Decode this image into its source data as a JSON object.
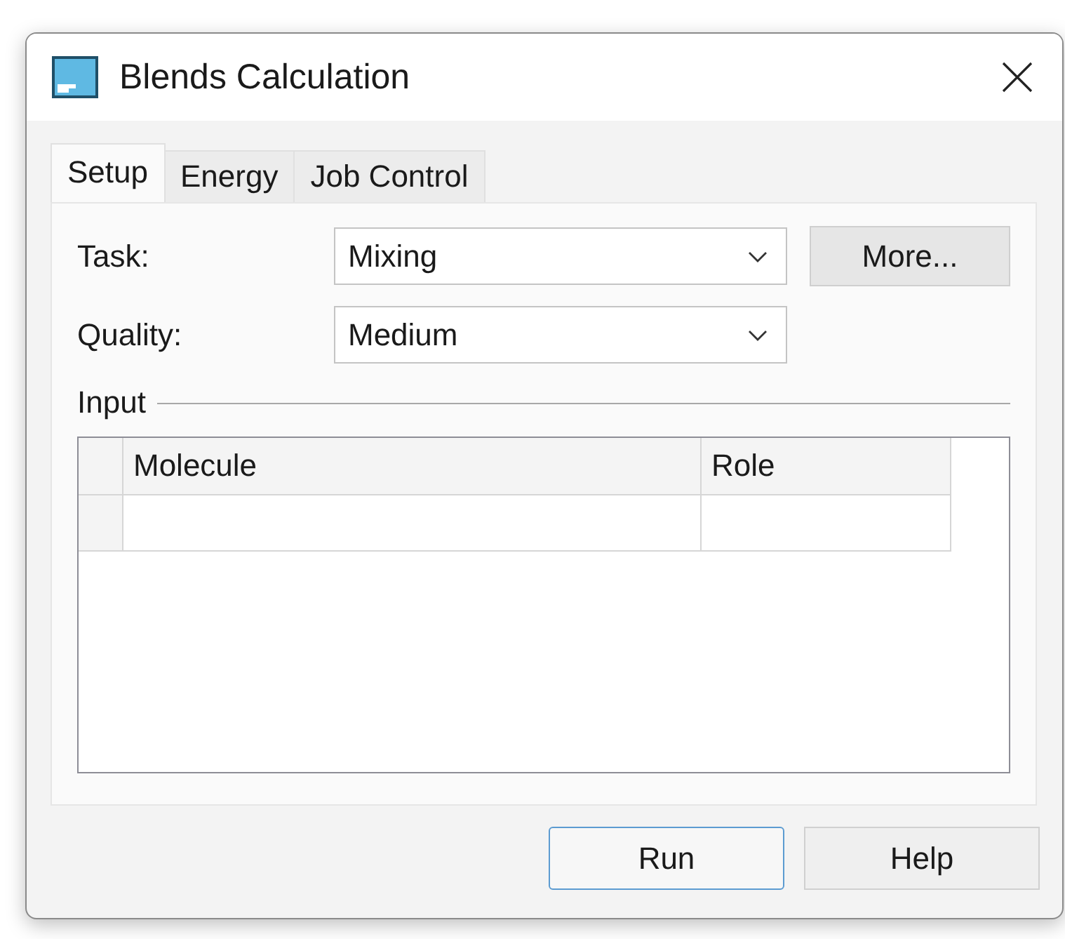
{
  "window": {
    "title": "Blends Calculation"
  },
  "tabs": [
    {
      "label": "Setup",
      "selected": true
    },
    {
      "label": "Energy",
      "selected": false
    },
    {
      "label": "Job Control",
      "selected": false
    }
  ],
  "fields": [
    {
      "label": "Task:",
      "value": "Mixing"
    },
    {
      "label": "Quality:",
      "value": "Medium"
    }
  ],
  "more_button": "More...",
  "input_group": {
    "title": "Input",
    "table": {
      "columns": [
        "Molecule",
        "Role"
      ]
    }
  },
  "buttons": [
    {
      "label": "Run",
      "default": true
    },
    {
      "label": "Help",
      "default": false
    }
  ]
}
